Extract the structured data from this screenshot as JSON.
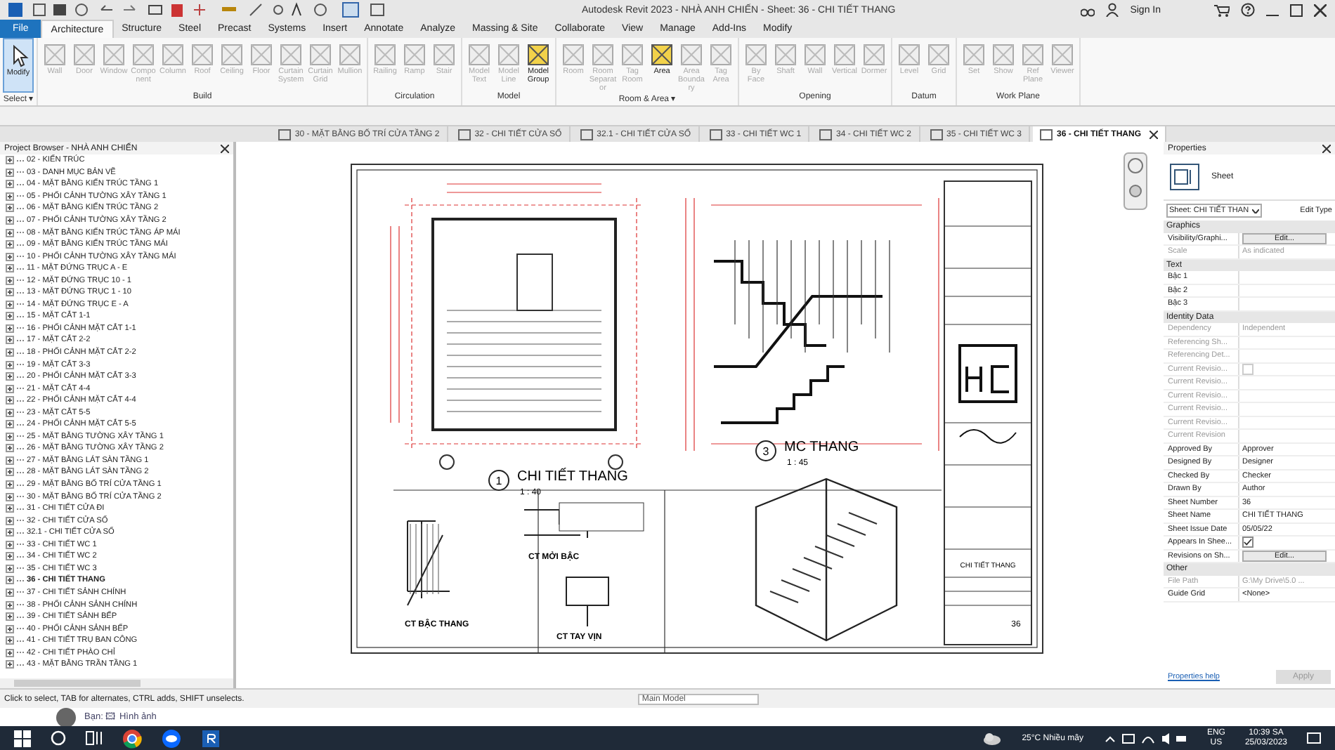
{
  "window": {
    "title": "Autodesk Revit 2023 - NHÀ ANH CHIẾN - Sheet: 36 - CHI TIẾT THANG",
    "sign_in": "Sign In"
  },
  "ribbon_tabs": [
    {
      "label": "File",
      "selected": false,
      "kind": "file"
    },
    {
      "label": "Architecture",
      "selected": true,
      "kind": "tab"
    },
    {
      "label": "Structure",
      "selected": false,
      "kind": "tab"
    },
    {
      "label": "Steel",
      "selected": false,
      "kind": "tab"
    },
    {
      "label": "Precast",
      "selected": false,
      "kind": "tab"
    },
    {
      "label": "Systems",
      "selected": false,
      "kind": "tab"
    },
    {
      "label": "Insert",
      "selected": false,
      "kind": "tab"
    },
    {
      "label": "Annotate",
      "selected": false,
      "kind": "tab"
    },
    {
      "label": "Analyze",
      "selected": false,
      "kind": "tab"
    },
    {
      "label": "Massing & Site",
      "selected": false,
      "kind": "tab"
    },
    {
      "label": "Collaborate",
      "selected": false,
      "kind": "tab"
    },
    {
      "label": "View",
      "selected": false,
      "kind": "tab"
    },
    {
      "label": "Manage",
      "selected": false,
      "kind": "tab"
    },
    {
      "label": "Add-Ins",
      "selected": false,
      "kind": "tab"
    },
    {
      "label": "Modify",
      "selected": false,
      "kind": "tab"
    }
  ],
  "ribbon_panels": [
    {
      "title": "Select ▾",
      "buttons": [
        {
          "label": "Modify",
          "disabled": false,
          "selected": true
        }
      ]
    },
    {
      "title": "Build",
      "buttons": [
        {
          "label": "Wall",
          "disabled": true,
          "selected": false
        },
        {
          "label": "Door",
          "disabled": true,
          "selected": false
        },
        {
          "label": "Window",
          "disabled": true,
          "selected": false
        },
        {
          "label": "Component",
          "disabled": true,
          "selected": false
        },
        {
          "label": "Column",
          "disabled": true,
          "selected": false
        },
        {
          "label": "Roof",
          "disabled": true,
          "selected": false
        },
        {
          "label": "Ceiling",
          "disabled": true,
          "selected": false
        },
        {
          "label": "Floor",
          "disabled": true,
          "selected": false
        },
        {
          "label": "Curtain System",
          "disabled": true,
          "selected": false
        },
        {
          "label": "Curtain Grid",
          "disabled": true,
          "selected": false
        },
        {
          "label": "Mullion",
          "disabled": true,
          "selected": false
        }
      ]
    },
    {
      "title": "Circulation",
      "buttons": [
        {
          "label": "Railing",
          "disabled": true,
          "selected": false
        },
        {
          "label": "Ramp",
          "disabled": true,
          "selected": false
        },
        {
          "label": "Stair",
          "disabled": true,
          "selected": false
        }
      ]
    },
    {
      "title": "Model",
      "buttons": [
        {
          "label": "Model Text",
          "disabled": true,
          "selected": false
        },
        {
          "label": "Model Line",
          "disabled": true,
          "selected": false
        },
        {
          "label": "Model Group",
          "disabled": false,
          "selected": false
        }
      ]
    },
    {
      "title": "Room & Area ▾",
      "buttons": [
        {
          "label": "Room",
          "disabled": true,
          "selected": false
        },
        {
          "label": "Room Separator",
          "disabled": true,
          "selected": false
        },
        {
          "label": "Tag Room",
          "disabled": true,
          "selected": false
        },
        {
          "label": "Area",
          "disabled": false,
          "selected": false
        },
        {
          "label": "Area Boundary",
          "disabled": true,
          "selected": false
        },
        {
          "label": "Tag Area",
          "disabled": true,
          "selected": false
        }
      ]
    },
    {
      "title": "Opening",
      "buttons": [
        {
          "label": "By Face",
          "disabled": true,
          "selected": false
        },
        {
          "label": "Shaft",
          "disabled": true,
          "selected": false
        },
        {
          "label": "Wall",
          "disabled": true,
          "selected": false
        },
        {
          "label": "Vertical",
          "disabled": true,
          "selected": false
        },
        {
          "label": "Dormer",
          "disabled": true,
          "selected": false
        }
      ]
    },
    {
      "title": "Datum",
      "buttons": [
        {
          "label": "Level",
          "disabled": true,
          "selected": false
        },
        {
          "label": "Grid",
          "disabled": true,
          "selected": false
        }
      ]
    },
    {
      "title": "Work Plane",
      "buttons": [
        {
          "label": "Set",
          "disabled": true,
          "selected": false
        },
        {
          "label": "Show",
          "disabled": true,
          "selected": false
        },
        {
          "label": "Ref Plane",
          "disabled": true,
          "selected": false
        },
        {
          "label": "Viewer",
          "disabled": true,
          "selected": false
        }
      ]
    }
  ],
  "view_tabs": [
    {
      "label": "30 - MẶT BẰNG BỐ TRÍ CỬA TẦNG 2",
      "selected": false
    },
    {
      "label": "32 - CHI TIẾT CỬA SỔ",
      "selected": false
    },
    {
      "label": "32.1 - CHI TIẾT CỬA SỔ",
      "selected": false
    },
    {
      "label": "33 - CHI TIẾT WC 1",
      "selected": false
    },
    {
      "label": "34 - CHI TIẾT WC 2",
      "selected": false
    },
    {
      "label": "35 - CHI TIẾT WC 3",
      "selected": false
    },
    {
      "label": "36 - CHI TIẾT THANG",
      "selected": true
    }
  ],
  "project_browser": {
    "title": "Project Browser - NHÀ ANH CHIẾN",
    "items": [
      {
        "label": "02 - KIẾN TRÚC",
        "selected": false
      },
      {
        "label": "03 - DANH MỤC BẢN VẼ",
        "selected": false
      },
      {
        "label": "04 - MẶT BẰNG KIẾN TRÚC TẦNG 1",
        "selected": false
      },
      {
        "label": "05 - PHỐI CẢNH TƯỜNG XÂY TẦNG 1",
        "selected": false
      },
      {
        "label": "06 - MẶT BẰNG KIẾN TRÚC TẦNG 2",
        "selected": false
      },
      {
        "label": "07 - PHỐI CẢNH TƯỜNG XÂY TẦNG 2",
        "selected": false
      },
      {
        "label": "08 - MẶT BẰNG KIẾN TRÚC TẦNG ÁP MÁI",
        "selected": false
      },
      {
        "label": "09 - MẶT BẰNG KIẾN TRÚC TẦNG MÁI",
        "selected": false
      },
      {
        "label": "10 - PHỐI CẢNH TƯỜNG XÂY TẦNG MÁI",
        "selected": false
      },
      {
        "label": "11 - MẶT ĐỨNG TRỤC A - E",
        "selected": false
      },
      {
        "label": "12 - MẶT ĐỨNG TRỤC 10 - 1",
        "selected": false
      },
      {
        "label": "13 - MẶT ĐỨNG TRỤC 1 - 10",
        "selected": false
      },
      {
        "label": "14 - MẶT ĐỨNG TRỤC E - A",
        "selected": false
      },
      {
        "label": "15 - MẶT CẮT 1-1",
        "selected": false
      },
      {
        "label": "16 - PHỐI CẢNH MẶT CẮT 1-1",
        "selected": false
      },
      {
        "label": "17 - MẶT CẮT 2-2",
        "selected": false
      },
      {
        "label": "18 - PHỐI CẢNH MẶT CẮT 2-2",
        "selected": false
      },
      {
        "label": "19 - MẶT CẮT 3-3",
        "selected": false
      },
      {
        "label": "20 - PHỐI CẢNH MẶT CẮT 3-3",
        "selected": false
      },
      {
        "label": "21 - MẶT CẮT 4-4",
        "selected": false
      },
      {
        "label": "22 - PHỐI CẢNH MẶT CẮT 4-4",
        "selected": false
      },
      {
        "label": "23 - MẶT CẮT 5-5",
        "selected": false
      },
      {
        "label": "24 - PHỐI CẢNH MẶT CẮT 5-5",
        "selected": false
      },
      {
        "label": "25 - MẶT BẰNG TƯỜNG XÂY TẦNG 1",
        "selected": false
      },
      {
        "label": "26 - MẶT BẰNG TƯỜNG XÂY TẦNG 2",
        "selected": false
      },
      {
        "label": "27 - MẶT BẰNG LÁT SÀN TẦNG 1",
        "selected": false
      },
      {
        "label": "28 - MẶT BẰNG LÁT SÀN TẦNG 2",
        "selected": false
      },
      {
        "label": "29 - MẶT BẰNG BỐ TRÍ CỬA TẦNG 1",
        "selected": false
      },
      {
        "label": "30 - MẶT BẰNG BỐ TRÍ CỬA TẦNG 2",
        "selected": false
      },
      {
        "label": "31 - CHI TIẾT CỬA ĐI",
        "selected": false
      },
      {
        "label": "32 - CHI TIẾT CỬA SỔ",
        "selected": false
      },
      {
        "label": "32.1 - CHI TIẾT CỬA SỔ",
        "selected": false
      },
      {
        "label": "33 - CHI TIẾT WC 1",
        "selected": false
      },
      {
        "label": "34 - CHI TIẾT WC 2",
        "selected": false
      },
      {
        "label": "35 - CHI TIẾT WC 3",
        "selected": false
      },
      {
        "label": "36 - CHI TIẾT THANG",
        "selected": true
      },
      {
        "label": "37 - CHI TIẾT SẢNH CHÍNH",
        "selected": false
      },
      {
        "label": "38 - PHỐI CẢNH SẢNH CHÍNH",
        "selected": false
      },
      {
        "label": "39 - CHI TIẾT SẢNH BẾP",
        "selected": false
      },
      {
        "label": "40 - PHỐI CẢNH SẢNH BẾP",
        "selected": false
      },
      {
        "label": "41 - CHI TIẾT TRỤ BAN CÔNG",
        "selected": false
      },
      {
        "label": "42 - CHI TIẾT PHÀO CHỈ",
        "selected": false
      },
      {
        "label": "43 - MẶT BẰNG TRẦN TẦNG 1",
        "selected": false
      }
    ]
  },
  "sheet": {
    "plan_title": "CHI TIẾT THANG",
    "plan_number": "1",
    "plan_scale": "1 : 40",
    "section_title": "MC THANG",
    "section_number": "3",
    "section_scale": "1 : 45",
    "details": [
      "CT BẬC THANG",
      "CT MỞI BẬC",
      "CT TAY VỊN"
    ],
    "title_block_name": "CHI TIẾT THANG",
    "title_block_number": "36"
  },
  "properties": {
    "title": "Properties",
    "type_name": "Sheet",
    "selector": "Sheet: CHI TIẾT THAN",
    "edit_type": "Edit Type",
    "groups": [
      {
        "name": "Graphics",
        "rows": [
          {
            "name": "Visibility/Graphi...",
            "value": "Edit...",
            "kind": "button",
            "disabled": false
          },
          {
            "name": "Scale",
            "value": "As indicated",
            "kind": "text",
            "disabled": true
          }
        ]
      },
      {
        "name": "Text",
        "rows": [
          {
            "name": "Bậc 1",
            "value": "",
            "kind": "text",
            "disabled": false
          },
          {
            "name": "Bậc 2",
            "value": "",
            "kind": "text",
            "disabled": false
          },
          {
            "name": "Bậc 3",
            "value": "",
            "kind": "text",
            "disabled": false
          }
        ]
      },
      {
        "name": "Identity Data",
        "rows": [
          {
            "name": "Dependency",
            "value": "Independent",
            "kind": "text",
            "disabled": true
          },
          {
            "name": "Referencing Sh...",
            "value": "",
            "kind": "text",
            "disabled": true
          },
          {
            "name": "Referencing Det...",
            "value": "",
            "kind": "text",
            "disabled": true
          },
          {
            "name": "Current Revisio...",
            "kind": "checkbox",
            "checked": false,
            "disabled": true
          },
          {
            "name": "Current Revisio...",
            "value": "",
            "kind": "text",
            "disabled": true
          },
          {
            "name": "Current Revisio...",
            "value": "",
            "kind": "text",
            "disabled": true
          },
          {
            "name": "Current Revisio...",
            "value": "",
            "kind": "text",
            "disabled": true
          },
          {
            "name": "Current Revisio...",
            "value": "",
            "kind": "text",
            "disabled": true
          },
          {
            "name": "Current Revision",
            "value": "",
            "kind": "text",
            "disabled": true
          },
          {
            "name": "Approved By",
            "value": "Approver",
            "kind": "text",
            "disabled": false
          },
          {
            "name": "Designed By",
            "value": "Designer",
            "kind": "text",
            "disabled": false
          },
          {
            "name": "Checked By",
            "value": "Checker",
            "kind": "text",
            "disabled": false
          },
          {
            "name": "Drawn By",
            "value": "Author",
            "kind": "text",
            "disabled": false
          },
          {
            "name": "Sheet Number",
            "value": "36",
            "kind": "text",
            "disabled": false
          },
          {
            "name": "Sheet Name",
            "value": "CHI TIẾT THANG",
            "kind": "text",
            "disabled": false
          },
          {
            "name": "Sheet Issue Date",
            "value": "05/05/22",
            "kind": "text",
            "disabled": false
          },
          {
            "name": "Appears In Shee...",
            "kind": "checkbox",
            "checked": true,
            "disabled": false
          },
          {
            "name": "Revisions on Sh...",
            "value": "Edit...",
            "kind": "button",
            "disabled": false
          }
        ]
      },
      {
        "name": "Other",
        "rows": [
          {
            "name": "File Path",
            "value": "G:\\My Drive\\5.0 ...",
            "kind": "text",
            "disabled": true
          },
          {
            "name": "Guide Grid",
            "value": "<None>",
            "kind": "text",
            "disabled": false
          }
        ]
      }
    ],
    "help": "Properties help",
    "apply": "Apply"
  },
  "status_bar": {
    "message": "Click to select, TAB for alternates, CTRL adds, SHIFT unselects.",
    "model": "Main Model"
  },
  "notification": {
    "text": "Bạn: 🖾 Hình ảnh"
  },
  "taskbar": {
    "weather": "25°C  Nhiều mây",
    "lang": "ENG",
    "region": "US",
    "time": "10:39 SA",
    "date": "25/03/2023"
  }
}
